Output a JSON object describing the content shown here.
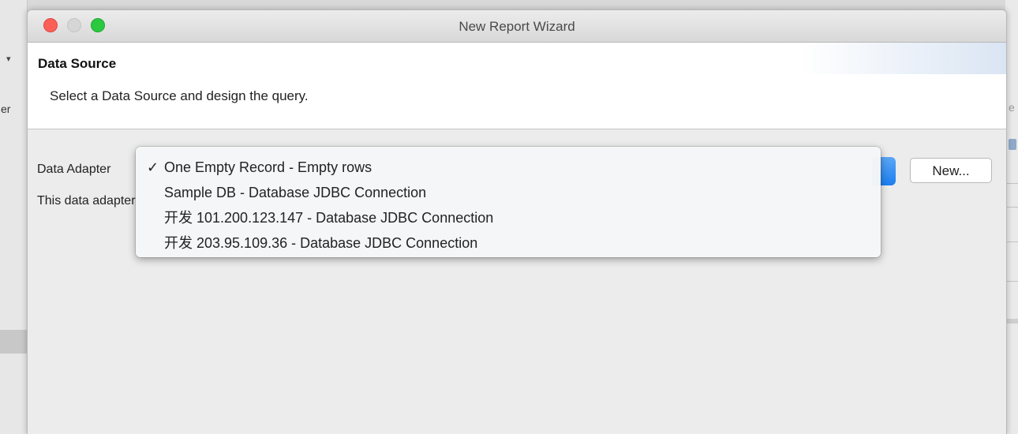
{
  "window": {
    "title": "New Report Wizard"
  },
  "page": {
    "title": "Data Source",
    "description": "Select a Data Source and design the query."
  },
  "form": {
    "adapter_label": "Data Adapter",
    "info_text": "This data adapter",
    "new_button": "New..."
  },
  "background": {
    "left_text": "er",
    "right_text": "e"
  },
  "dropdown": {
    "check_mark": "✓",
    "selected_index": 0,
    "options": [
      {
        "label": "One Empty Record - Empty rows"
      },
      {
        "label": "Sample DB - Database JDBC Connection"
      },
      {
        "label": "开发 101.200.123.147 - Database JDBC Connection"
      },
      {
        "label": "开发 203.95.109.36 - Database JDBC Connection"
      }
    ]
  }
}
